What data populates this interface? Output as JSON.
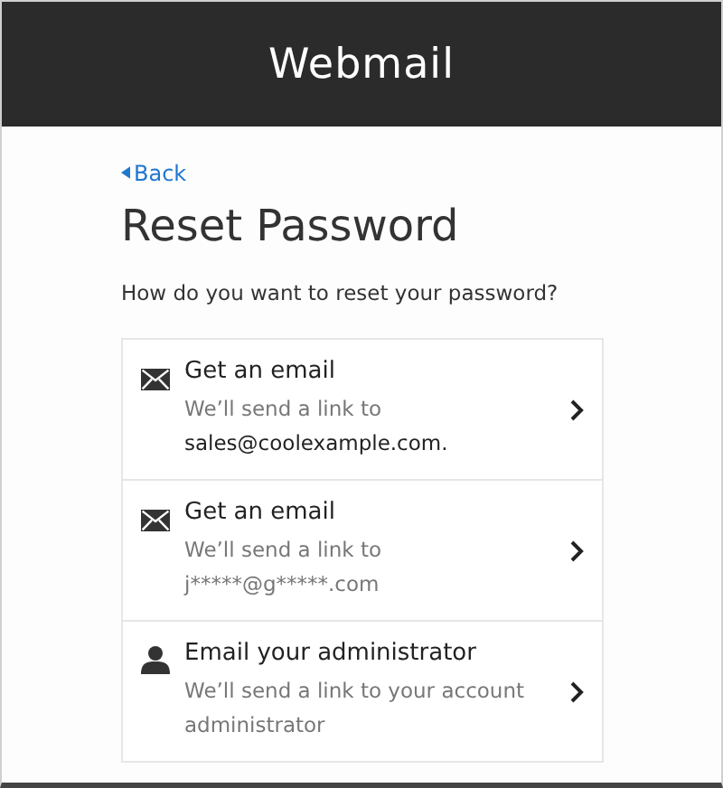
{
  "header": {
    "title": "Webmail"
  },
  "back_link": {
    "label": "Back"
  },
  "heading": "Reset Password",
  "prompt": "How do you want to reset your password?",
  "options": [
    {
      "kind": "email",
      "title": "Get an email",
      "lines": [
        {
          "text": "We’ll send a link to",
          "emphasis": false
        },
        {
          "text": "sales@coolexample.com.",
          "emphasis": true
        }
      ]
    },
    {
      "kind": "email",
      "title": "Get an email",
      "lines": [
        {
          "text": "We’ll send a link to",
          "emphasis": false
        },
        {
          "text": "j*****@g*****.com",
          "emphasis": false
        }
      ]
    },
    {
      "kind": "admin",
      "title": "Email your administrator",
      "lines": [
        {
          "text": "We’ll send a link to your account administrator",
          "emphasis": false
        }
      ]
    }
  ]
}
